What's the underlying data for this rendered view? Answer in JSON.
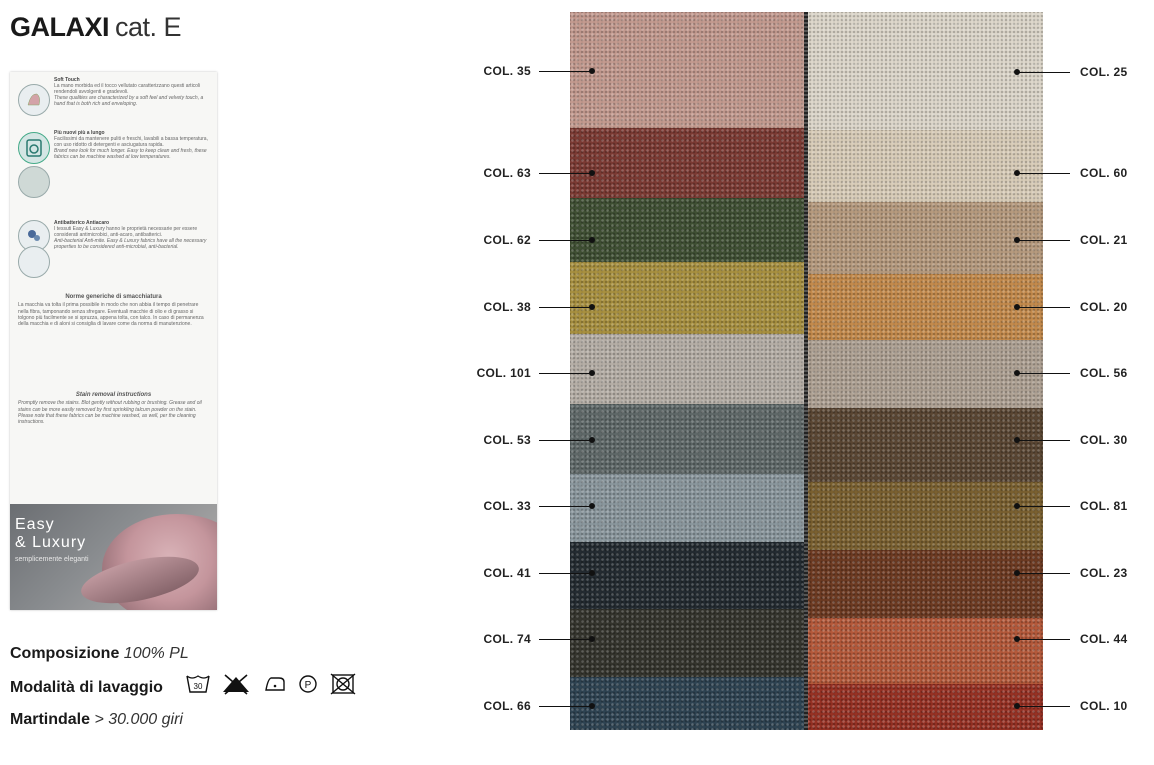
{
  "header": {
    "name": "GALAXI",
    "category": "cat. E"
  },
  "sheet": {
    "features": [
      {
        "icon": "hand-touch-icon",
        "title": "Soft Touch",
        "it": "La mano morbida ed il tocco vellutato caratterizzano questi articoli rendendoli avvolgenti e gradevoli.",
        "en": "These qualities are characterized by a soft feel and velvety touch, a hand that is both rich and enveloping."
      },
      {
        "icon": "washing-icon",
        "title": "Più nuovi più a lungo",
        "it": "Facilissimi da mantenere puliti e freschi, lavabili a bassa temperatura, con uso ridotto di detergenti e asciugatura rapida.",
        "en": "Brand new look for much longer. Easy to keep clean and fresh, these fabrics can be machine washed at low temperatures."
      },
      {
        "icon": "mite-icon",
        "title": "Antibatterico Antiacaro",
        "it": "I tessuti Easy & Luxury hanno le proprietà necessarie per essere considerati antimicrobici, anti-acaro, antibatterici.",
        "en": "Anti-bacterial Anti-mite. Easy & Luxury fabrics have all the necessary properties to be considered anti-microbial, anti-bacterial."
      }
    ],
    "stain_it_title": "Norme generiche di smacchiatura",
    "stain_it": "La macchia va tolta il prima possibile in modo che non abbia il tempo di penetrare nella fibra, tamponando senza sfregare. Eventuali macchie di olio e di grasso si tolgono più facilmente se si spruzza, appena tolta, con talco. In caso di permanenza della macchia e di aloni si consiglia di lavare come da norma di manutenzione.",
    "stain_en_title": "Stain removal instructions",
    "stain_en": "Promptly remove the stains. Blot gently without rubbing or brushing. Grease and oil stains can be more easily removed by first sprinkling talcum powder on the stain. Please note that these fabrics can be machine washed, as well, per the cleaning instructions.",
    "promo": {
      "line1": "Easy",
      "line2": "& Luxury",
      "tagline": "semplicemente eleganti"
    }
  },
  "specs": {
    "composition_label": "Composizione",
    "composition_value": "100% PL",
    "washing_label": "Modalità di lavaggio",
    "care_icons": [
      "wash-30-icon",
      "no-bleach-icon",
      "iron-low-icon",
      "dry-clean-p-icon",
      "no-tumble-dry-icon"
    ],
    "martindale_label": "Martindale",
    "martindale_value": "> 30.000 giri"
  },
  "swatches": {
    "left": [
      {
        "code": "COL. 35",
        "color": "#c39a8f"
      },
      {
        "code": "COL. 63",
        "color": "#7b3a33"
      },
      {
        "code": "COL. 62",
        "color": "#3f4f33"
      },
      {
        "code": "COL. 38",
        "color": "#a89040"
      },
      {
        "code": "COL. 101",
        "color": "#b5aea6"
      },
      {
        "code": "COL. 53",
        "color": "#5f6868"
      },
      {
        "code": "COL. 33",
        "color": "#8a979d"
      },
      {
        "code": "COL. 41",
        "color": "#242b31"
      },
      {
        "code": "COL. 74",
        "color": "#34342d"
      },
      {
        "code": "COL. 66",
        "color": "#2e4352"
      }
    ],
    "right": [
      {
        "code": "COL. 25",
        "color": "#ddd7cb"
      },
      {
        "code": "COL. 60",
        "color": "#d8ccb8"
      },
      {
        "code": "COL. 21",
        "color": "#b69a7e"
      },
      {
        "code": "COL. 20",
        "color": "#c38a4c"
      },
      {
        "code": "COL. 56",
        "color": "#aea193"
      },
      {
        "code": "COL. 30",
        "color": "#5a4633"
      },
      {
        "code": "COL. 81",
        "color": "#7a6030"
      },
      {
        "code": "COL. 23",
        "color": "#6d3a22"
      },
      {
        "code": "COL. 44",
        "color": "#b4593a"
      },
      {
        "code": "COL. 10",
        "color": "#963124"
      }
    ]
  }
}
